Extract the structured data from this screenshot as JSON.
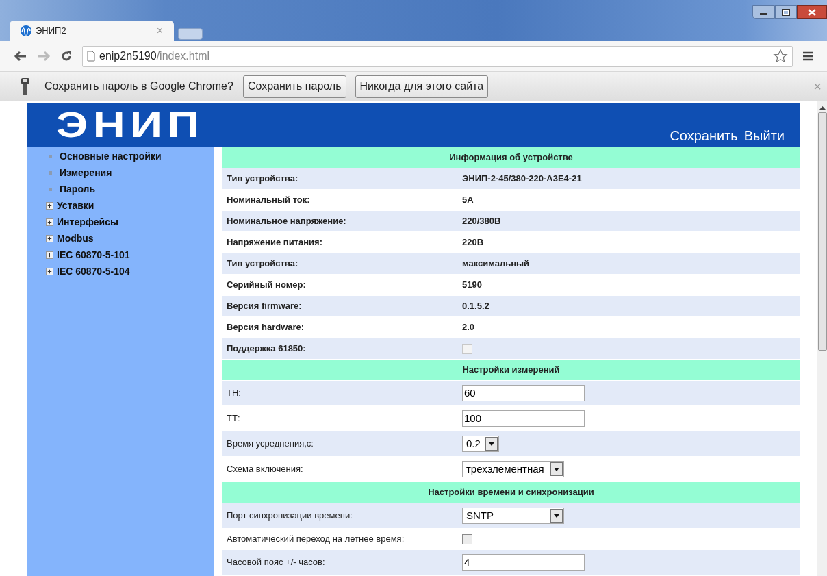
{
  "browser": {
    "tabs": [
      {
        "title": "ЭНИП2",
        "close": "×",
        "selected": true
      }
    ],
    "address": {
      "host": "enip2n5190",
      "path": "/index.html"
    },
    "password_bar": {
      "message": "Сохранить пароль в Google Chrome?",
      "buttons": [
        "Сохранить пароль",
        "Никогда для этого сайта"
      ],
      "close": "×"
    }
  },
  "header": {
    "logo": "ЭНИП",
    "actions": [
      "Сохранить",
      "Выйти"
    ]
  },
  "sidebar": {
    "items": [
      {
        "label": "Основные настройки",
        "kind": "page"
      },
      {
        "label": "Измерения",
        "kind": "page"
      },
      {
        "label": "Пароль",
        "kind": "page"
      },
      {
        "label": "Уставки",
        "kind": "group",
        "expanded": false
      },
      {
        "label": "Интерфейсы",
        "kind": "group",
        "expanded": false
      },
      {
        "label": "Modbus",
        "kind": "group",
        "expanded": false
      },
      {
        "label": "IEC 60870-5-101",
        "kind": "group",
        "expanded": false
      },
      {
        "label": "IEC 60870-5-104",
        "kind": "group",
        "expanded": false
      }
    ]
  },
  "sections": [
    {
      "title": "Информация об устройстве",
      "rows": [
        {
          "label": "Тип устройства:",
          "kind": "text",
          "value": "ЭНИП-2-45/380-220-А3Е4-21"
        },
        {
          "label": "Номинальный ток:",
          "kind": "text",
          "value": "5А"
        },
        {
          "label": "Номинальное напряжение:",
          "kind": "text",
          "value": "220/380В"
        },
        {
          "label": "Напряжение питания:",
          "kind": "text",
          "value": "220В"
        },
        {
          "label": "Тип устройства:",
          "kind": "text",
          "value": "максимальный"
        },
        {
          "label": "Серийный номер:",
          "kind": "text",
          "value": "5190"
        },
        {
          "label": "Версия firmware:",
          "kind": "text",
          "value": "0.1.5.2"
        },
        {
          "label": "Версия hardware:",
          "kind": "text",
          "value": "2.0"
        },
        {
          "label": "Поддержка 61850:",
          "kind": "checkbox",
          "checked": false,
          "disabled": true
        }
      ]
    },
    {
      "title": "Настройки измерений",
      "rows": [
        {
          "label": "ТН:",
          "kind": "input",
          "value": "60"
        },
        {
          "label": "ТТ:",
          "kind": "input",
          "value": "100"
        },
        {
          "label": "Время усреднения,с:",
          "kind": "select",
          "value": "0.2"
        },
        {
          "label": "Схема включения:",
          "kind": "select",
          "value": "трехэлементная"
        }
      ]
    },
    {
      "title": "Настройки времени и синхронизации",
      "rows": [
        {
          "label": "Порт синхронизации времени:",
          "kind": "select",
          "value": "SNTP"
        },
        {
          "label": "Автоматический переход на летнее время:",
          "kind": "checkbox",
          "checked": false,
          "disabled": false
        },
        {
          "label": "Часовой пояс +/- часов:",
          "kind": "input",
          "value": "4"
        }
      ]
    }
  ]
}
